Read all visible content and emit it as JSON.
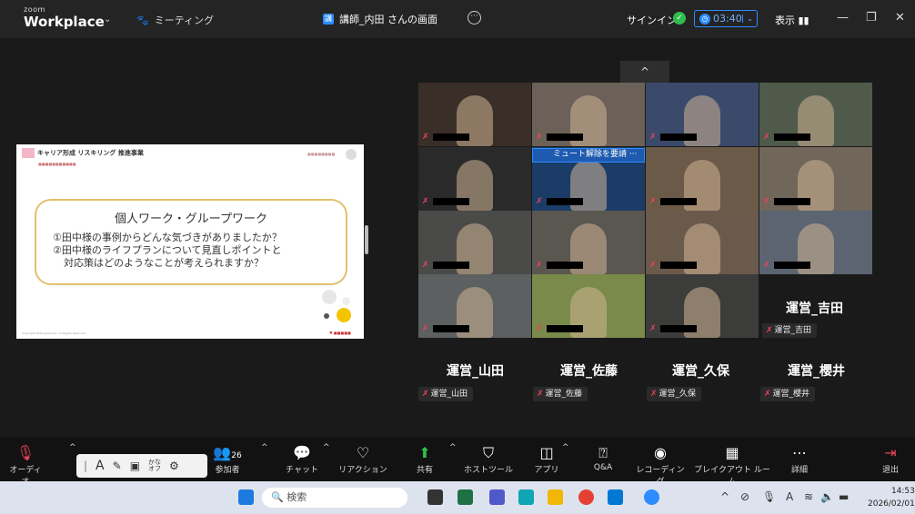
{
  "titlebar": {
    "brand_top": "zoom",
    "brand_bottom": "Workplace",
    "meeting_label": "ミーティング",
    "share_tab": "講師_内田 さんの画面",
    "sign_in": "サインイン",
    "timer": "03:40",
    "view_label": "表示"
  },
  "slide": {
    "program_name": "キャリア形成 リスキリング 推進事業",
    "heading": "個人ワーク・グループワーク",
    "line1": "①田中様の事例からどんな気づきがありましたか？",
    "line2": "②田中様のライフプランについて見直しポイントと",
    "line3": "対応策はどのようなことが考えられますか？",
    "footer": "Copyright 2024 Japanresc. All Rights Reserved"
  },
  "gallery": {
    "highlight_label": "ミュート解除を要請",
    "tiles_colors": [
      "#3a2f28",
      "#6b6158",
      "#3b4a6a",
      "#4f5a4a",
      "#2a2a2a",
      "#1b3c66",
      "#6b5a48",
      "#70665a",
      "#4a4a48",
      "#5a5650",
      "#6a5a4c",
      "#5b6470",
      "#5c6060",
      "#7a8a4a",
      "#3c3c3a"
    ],
    "no_video": [
      {
        "big": "運営_吉田",
        "pill": "運営_吉田"
      },
      {
        "big": "運営_山田",
        "pill": "運営_山田"
      },
      {
        "big": "運営_佐藤",
        "pill": "運営_佐藤"
      },
      {
        "big": "運営_久保",
        "pill": "運営_久保"
      },
      {
        "big": "運営_櫻井",
        "pill": "運営_櫻井"
      }
    ]
  },
  "toolbar": {
    "audio": "オーディオ",
    "participants_count": "26",
    "participants": "参加者",
    "chat": "チャット",
    "reactions": "リアクション",
    "share": "共有",
    "host_tools": "ホストツール",
    "apps": "アプリ",
    "qa": "Q&A",
    "recording": "レコーディング",
    "breakout": "ブレイクアウト ルーム",
    "more": "詳細",
    "leave": "退出"
  },
  "ime": {
    "kana_top": "かな",
    "kana_bottom": "オフ"
  },
  "taskbar": {
    "search_placeholder": "検索",
    "time": "14:53",
    "date": "2026/02/01"
  }
}
